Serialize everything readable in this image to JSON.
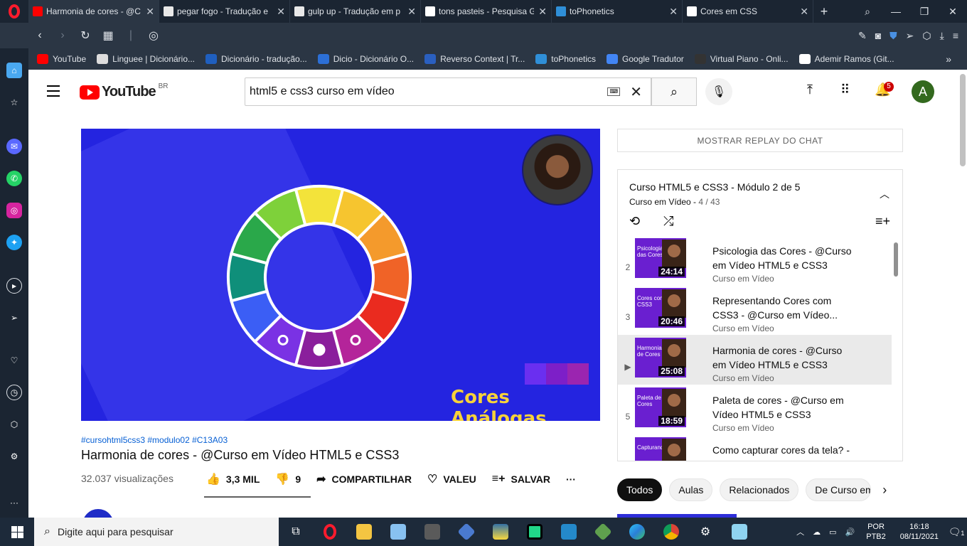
{
  "browser": {
    "tabs": [
      {
        "title": "Harmonia de cores - @C",
        "color": "#ff0000",
        "active": true
      },
      {
        "title": "pegar fogo - Tradução e",
        "color": "#e8e8e8",
        "active": false
      },
      {
        "title": "gulp up - Tradução em p",
        "color": "#e8e8e8",
        "active": false
      },
      {
        "title": "tons pasteis - Pesquisa G",
        "color": "#ffffff",
        "active": false
      },
      {
        "title": "toPhonetics",
        "color": "#2f8fd8",
        "active": false
      },
      {
        "title": "Cores em CSS",
        "color": "#ffffff",
        "active": false
      }
    ],
    "bookmarks": [
      {
        "label": "YouTube",
        "color": "#ff0000"
      },
      {
        "label": "Linguee | Dicionário...",
        "color": "#dddddd"
      },
      {
        "label": "Dicionário - tradução...",
        "color": "#1f5fbf"
      },
      {
        "label": "Dicio - Dicionário O...",
        "color": "#2c6fd6"
      },
      {
        "label": "Reverso Context | Tr...",
        "color": "#2a5fbf"
      },
      {
        "label": "toPhonetics",
        "color": "#2f8fd8"
      },
      {
        "label": "Google Tradutor",
        "color": "#4285f4"
      },
      {
        "label": "Virtual Piano - Onli...",
        "color": "#333333"
      },
      {
        "label": "Ademir Ramos (Git...",
        "color": "#ffffff"
      }
    ],
    "bookmarks_more": "»"
  },
  "youtube": {
    "logo_text": "YouTube",
    "country": "BR",
    "search_value": "html5 e css3 curso em vídeo",
    "notifications": "5",
    "avatar_letter": "A"
  },
  "video": {
    "caption": "Cores Análogas",
    "tags": "#cursohtml5css3 #modulo02 #C13A03",
    "title": "Harmonia de cores - @Curso em Vídeo HTML5 e CSS3",
    "views": "32.037 visualizações",
    "likes": "3,3 MIL",
    "dislikes": "9",
    "share": "COMPARTILHAR",
    "thanks": "VALEU",
    "save": "SALVAR",
    "more": "···",
    "wheel_colors": [
      "#f3e33a",
      "#f6c52f",
      "#f49a2c",
      "#f06327",
      "#ea2b1f",
      "#b4249a",
      "#8a1f9c",
      "#7a32e4",
      "#3b5ef5",
      "#0f8f7a",
      "#2aa84a",
      "#7ed13a"
    ],
    "analog_colors": [
      "#6a2ff0",
      "#7d1fc8",
      "#9b25b0"
    ]
  },
  "chat": {
    "replay_label": "MOSTRAR REPLAY DO CHAT"
  },
  "playlist": {
    "title": "Curso HTML5 e CSS3 - Módulo 2 de 5",
    "channel": "Curso em Vídeo",
    "position": "4 / 43",
    "items": [
      {
        "index": "2",
        "label": "Psicologia das Cores",
        "duration": "24:14",
        "title": "Psicologia das Cores - @Curso em Vídeo HTML5 e CSS3",
        "channel": "Curso em Vídeo"
      },
      {
        "index": "3",
        "label": "Cores com CSS3",
        "duration": "20:46",
        "title": "Representando Cores com CSS3 - @Curso em Vídeo...",
        "channel": "Curso em Vídeo"
      },
      {
        "index": "▶",
        "label": "Harmonia de Cores",
        "duration": "25:08",
        "title": "Harmonia de cores - @Curso em Vídeo HTML5 e CSS3",
        "channel": "Curso em Vídeo"
      },
      {
        "index": "5",
        "label": "Paleta de Cores",
        "duration": "18:59",
        "title": "Paleta de cores - @Curso em Vídeo HTML5 e CSS3",
        "channel": "Curso em Vídeo"
      },
      {
        "index": "",
        "label": "Capturando",
        "duration": "",
        "title": "Como capturar cores da tela? -",
        "channel": ""
      }
    ]
  },
  "chips": [
    "Todos",
    "Aulas",
    "Relacionados",
    "De Curso em"
  ],
  "taskbar": {
    "search_placeholder": "Digite aqui para pesquisar",
    "lang_top": "POR",
    "lang_bottom": "PTB2",
    "time": "16:18",
    "date": "08/11/2021",
    "notif_count": "1"
  }
}
